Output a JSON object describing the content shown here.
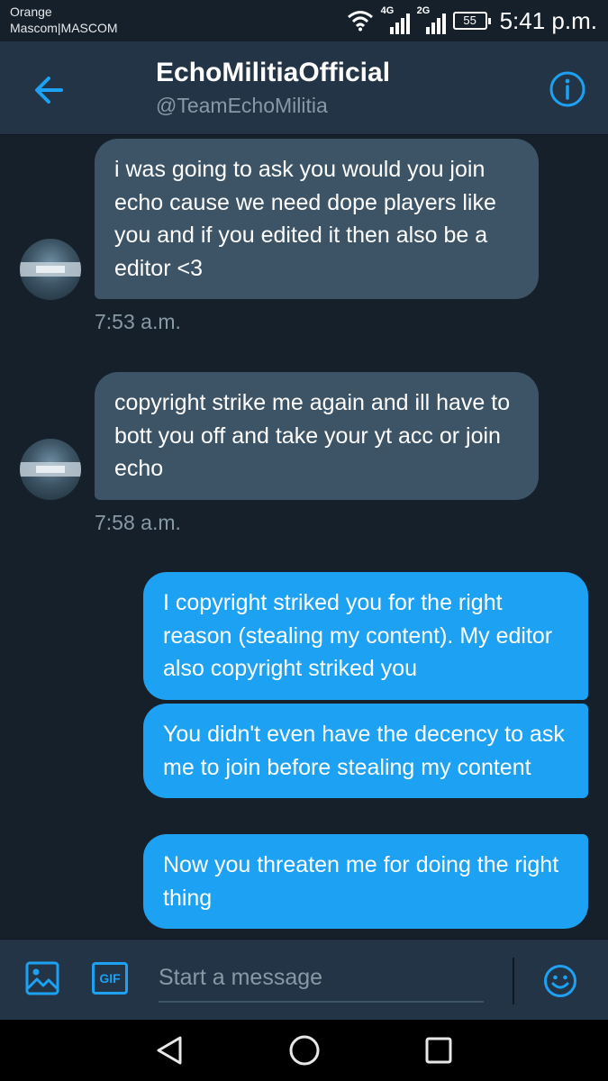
{
  "status_bar": {
    "carrier_line1": "Orange",
    "carrier_line2": "Mascom|MASCOM",
    "net1": "4G",
    "net2": "2G",
    "battery": "55",
    "time": "5:41 p.m."
  },
  "header": {
    "title": "EchoMilitiaOfficial",
    "handle": "@TeamEchoMilitia",
    "back_icon": "arrow-left-icon",
    "info_icon": "info-icon"
  },
  "messages": [
    {
      "direction": "received",
      "text": "i was going to ask you would you join echo cause we need dope players like you and if you edited it then also be a editor <3",
      "time": "7:53 a.m."
    },
    {
      "direction": "received",
      "text": "copyright strike me again and ill have to bott you off and take your yt acc or join echo",
      "time": "7:58 a.m."
    },
    {
      "direction": "sent",
      "text": "I copyright striked you for the right reason (stealing my content). My editor also copyright striked you"
    },
    {
      "direction": "sent",
      "text": "You didn't even have the decency to ask me to join before stealing my content"
    },
    {
      "direction": "sent",
      "text": "Now you threaten me for doing the right thing"
    }
  ],
  "composer": {
    "placeholder": "Start a message",
    "gif_label": "GIF",
    "media_icon": "image-icon",
    "emoji_icon": "smiley-icon"
  },
  "colors": {
    "background": "#15202b",
    "header": "#243447",
    "received_bubble": "#3d5466",
    "sent_bubble": "#1da1f2",
    "accent": "#1da1f2",
    "muted_text": "#8899a6"
  }
}
